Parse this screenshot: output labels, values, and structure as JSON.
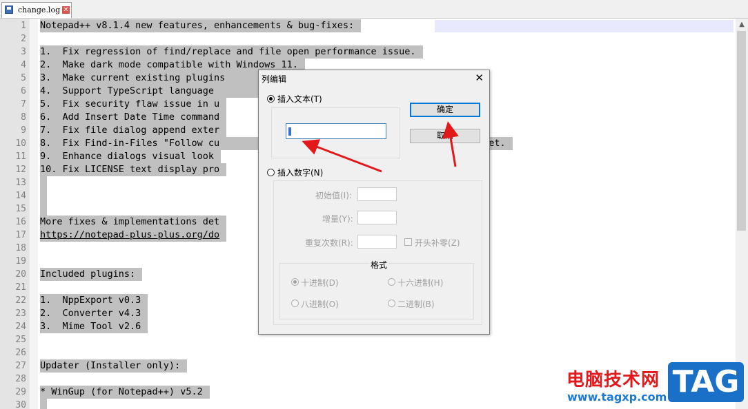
{
  "tab": {
    "filename": "change.log",
    "close_glyph": "✕"
  },
  "editor": {
    "lines": [
      {
        "n": "1",
        "text": "Notepad++ v8.1.4 new features, enhancements & bug-fixes:"
      },
      {
        "n": "2",
        "text": ""
      },
      {
        "n": "3",
        "text": "1.  Fix regression of find/replace and file open performance issue."
      },
      {
        "n": "4",
        "text": "2.  Make dark mode compatible with Windows 11."
      },
      {
        "n": "5",
        "text": "3.  Make current existing plugins                          light and dark mode."
      },
      {
        "n": "6",
        "text": "4.  Support TypeScript language                         tion & function list)."
      },
      {
        "n": "7",
        "text": "5.  Fix security flaw issue in u"
      },
      {
        "n": "8",
        "text": "6.  Add Insert Date Time command"
      },
      {
        "n": "9",
        "text": "7.  Fix file dialog append exter"
      },
      {
        "n": "10",
        "text": "8.  Fix Find-in-Files \"Follow cu                          Default Directory is set."
      },
      {
        "n": "11",
        "text": "9.  Enhance dialogs visual look"
      },
      {
        "n": "12",
        "text": "10. Fix LICENSE text display pro"
      },
      {
        "n": "13",
        "text": ""
      },
      {
        "n": "14",
        "text": ""
      },
      {
        "n": "15",
        "text": ""
      },
      {
        "n": "16",
        "text": "More fixes & implementations det"
      },
      {
        "n": "17",
        "text": "https://notepad-plus-plus.org/do"
      },
      {
        "n": "18",
        "text": ""
      },
      {
        "n": "19",
        "text": ""
      },
      {
        "n": "20",
        "text": "Included plugins:"
      },
      {
        "n": "21",
        "text": ""
      },
      {
        "n": "22",
        "text": "1.  NppExport v0.3"
      },
      {
        "n": "23",
        "text": "2.  Converter v4.3"
      },
      {
        "n": "24",
        "text": "3.  Mime Tool v2.6"
      },
      {
        "n": "25",
        "text": ""
      },
      {
        "n": "26",
        "text": ""
      },
      {
        "n": "27",
        "text": "Updater (Installer only):"
      },
      {
        "n": "28",
        "text": ""
      },
      {
        "n": "29",
        "text": "* WinGup (for Notepad++) v5.2"
      },
      {
        "n": "30",
        "text": ""
      }
    ]
  },
  "dialog": {
    "title": "列编辑",
    "close_glyph": "✕",
    "insert_text_label": "插入文本(T)",
    "text_value": "",
    "ok_label": "确定",
    "cancel_label": "取消",
    "insert_number_label": "插入数字(N)",
    "initial_label": "初始值(I):",
    "increment_label": "增量(Y):",
    "repeat_label": "重复次数(R):",
    "leading_zero_label": "开头补零(Z)",
    "format_title": "格式",
    "formats": {
      "dec": "十进制(D)",
      "hex": "十六进制(H)",
      "oct": "八进制(O)",
      "bin": "二进制(B)"
    }
  },
  "watermark": {
    "site_name": "电脑技术网",
    "url": "www.tagxp.com",
    "logo": "TAG"
  },
  "colors": {
    "selection": "#c0c0c0",
    "arrow": "#e3181b",
    "default_button_border": "#0078d7"
  }
}
